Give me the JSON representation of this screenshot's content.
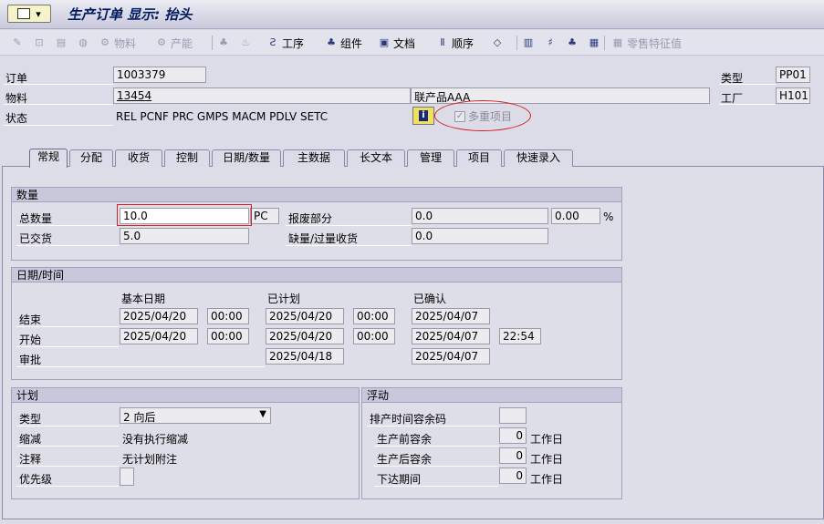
{
  "title": "生产订单 显示: 抬头",
  "menu_btn_glyph": "▾",
  "toolbar": [
    {
      "label": "",
      "icon": "✎",
      "dis": true
    },
    {
      "label": "",
      "icon": "⊡",
      "dis": true
    },
    {
      "label": "",
      "icon": "▤",
      "dis": true
    },
    {
      "label": "",
      "icon": "◍",
      "dis": true
    },
    {
      "label": "物料",
      "icon": "⚙",
      "dis": true
    },
    {
      "label": "产能",
      "icon": "⚙",
      "dis": true
    },
    {
      "label": "",
      "icon": "♣",
      "dis": true
    },
    {
      "label": "",
      "icon": "♨",
      "dis": true
    },
    {
      "label": "工序",
      "icon": "Ƨ",
      "dis": false
    },
    {
      "label": "组件",
      "icon": "♣",
      "dis": false
    },
    {
      "label": "文档",
      "icon": "▣",
      "dis": false
    },
    {
      "label": "顺序",
      "icon": "Ⅱ",
      "dis": false
    },
    {
      "label": "",
      "icon": "◇",
      "dis": false
    },
    {
      "label": "",
      "icon": "▥",
      "dis": false
    },
    {
      "label": "",
      "icon": "♯",
      "dis": false
    },
    {
      "label": "",
      "icon": "♣",
      "dis": false
    },
    {
      "label": "",
      "icon": "▦",
      "dis": false
    },
    {
      "label": "零售特征值",
      "icon": "▦",
      "dis": true
    }
  ],
  "header": {
    "order_label": "订单",
    "order_value": "1003379",
    "material_label": "物料",
    "material_value": "13454",
    "material_desc": "联产品AAA",
    "status_label": "状态",
    "status_value": "REL  PCNF PRC  GMPS MACM PDLV SETC",
    "info_btn": "i",
    "multi_item_label": "多重项目",
    "type_label": "类型",
    "type_value": "PP01",
    "plant_label": "工厂",
    "plant_value": "H101"
  },
  "tabs": [
    "常规",
    "分配",
    "收货",
    "控制",
    "日期/数量",
    "主数据",
    "长文本",
    "管理",
    "项目",
    "快速录入"
  ],
  "qty": {
    "title": "数量",
    "total_label": "总数量",
    "total_value": "10.0",
    "unit": "PC",
    "delivered_label": "已交货",
    "delivered_value": "5.0",
    "scrap_label": "报废部分",
    "scrap_value": "0.0",
    "scrap_pct": "0.00",
    "pct": "%",
    "short_label": "缺量/过量收货",
    "short_value": "0.0"
  },
  "dates": {
    "title": "日期/时间",
    "col_basic": "基本日期",
    "col_sched": "已计划",
    "col_conf": "已确认",
    "end_label": "结束",
    "start_label": "开始",
    "release_label": "审批",
    "end_basic": "2025/04/20",
    "end_basic_t": "00:00",
    "end_sched": "2025/04/20",
    "end_sched_t": "00:00",
    "end_conf": "2025/04/07",
    "start_basic": "2025/04/20",
    "start_basic_t": "00:00",
    "start_sched": "2025/04/20",
    "start_sched_t": "00:00",
    "start_conf": "2025/04/07",
    "start_conf_t": "22:54",
    "release_sched": "2025/04/18",
    "release_conf": "2025/04/07"
  },
  "plan": {
    "title": "计划",
    "type_label": "类型",
    "type_value": "2 向后",
    "reduce_label": "缩减",
    "reduce_value": "没有执行缩减",
    "note_label": "注释",
    "note_value": "无计划附注",
    "prio_label": "优先级"
  },
  "float": {
    "title": "浮动",
    "key_label": "排产时间容余码",
    "before_label": "生产前容余",
    "before_value": "0",
    "before_unit": "工作日",
    "after_label": "生产后容余",
    "after_value": "0",
    "after_unit": "工作日",
    "release_label": "下达期间",
    "release_value": "0",
    "release_unit": "工作日"
  }
}
